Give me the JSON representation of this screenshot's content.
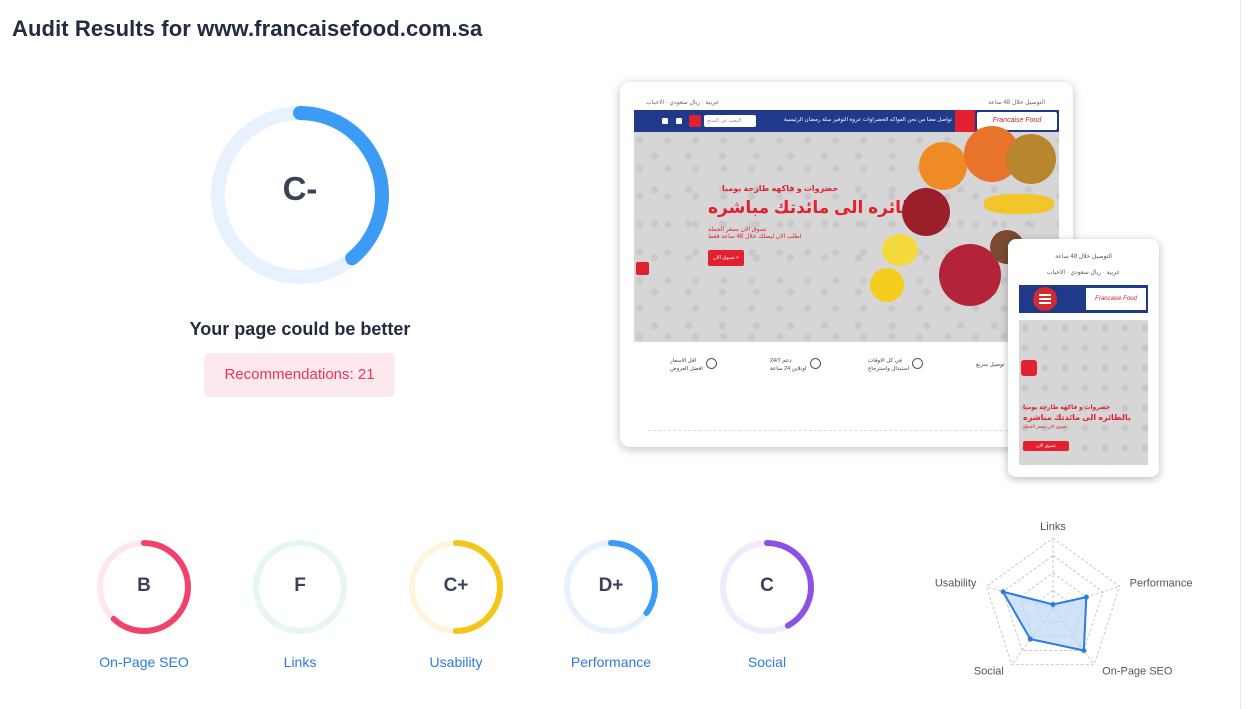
{
  "page_title": "Audit Results for www.francaisefood.com.sa",
  "overall": {
    "grade": "C-",
    "progress": 0.39,
    "color": "#3c9bf5",
    "track_color": "#e8f2fe",
    "verdict": "Your page could be better",
    "recommendations_label": "Recommendations: 21"
  },
  "desktop_preview": {
    "topbar_left": "عربية · ريال سعودي · الاحباب",
    "topbar_right": "التوصيل خلال 48 ساعة",
    "nav_items": "تواصل معنا   من نحن   الفواكه   الخضراوات   عروة التوفير   سلة رمضان   الرئيسية",
    "search_placeholder": "البحث عن المنتج",
    "logo_text": "Francaise Food",
    "hero_sub": "خضروات و فاكهه طازجة يوميا",
    "hero_title": "بالطائره الى مائدتك مباشره",
    "hero_line1": "تسوق الان بسعر الجملة",
    "hero_line2": "اطلب الان ليصلك خلال 48 ساعة فقط",
    "hero_button": "تسوق الان »",
    "features": [
      {
        "title": "اقل الاسعار",
        "sub": "افضل العروض"
      },
      {
        "title": "24/7 دعم",
        "sub": "اونلاين 24 ساعة"
      },
      {
        "title": "في كل الاوقات",
        "sub": "استبدال واسترجاع"
      },
      {
        "title": "توصيل سريع",
        "sub": ""
      }
    ]
  },
  "mobile_preview": {
    "top_text": "التوصيل خلال 48 ساعة",
    "selects": "عربية · ريال سعودي · الاحباب",
    "logo_text": "Francaise Food",
    "hero_sub": "خضروات و فاكهه طازجة يوميا",
    "hero_title": "بالطائره الى مائدتك مباشره",
    "hero_line": "تسوق الان بسعر الجملة",
    "hero_button": "تسوق الان"
  },
  "categories": [
    {
      "grade": "B",
      "label": "On-Page SEO",
      "progress": 0.62,
      "color": "#f0426c",
      "track": "#fde7ec"
    },
    {
      "grade": "F",
      "label": "Links",
      "progress": 0.0,
      "color": "#3ecf6e",
      "track": "#e6f8ec"
    },
    {
      "grade": "C+",
      "label": "Usability",
      "progress": 0.5,
      "color": "#f5c518",
      "track": "#fdf5dc"
    },
    {
      "grade": "D+",
      "label": "Performance",
      "progress": 0.35,
      "color": "#3c9bf5",
      "track": "#e8f2fe"
    },
    {
      "grade": "C",
      "label": "Social",
      "progress": 0.42,
      "color": "#8c52e6",
      "track": "#f0eafc"
    }
  ],
  "radar": {
    "axes": [
      "Links",
      "Performance",
      "On-Page SEO",
      "Social",
      "Usability"
    ],
    "values": [
      0.05,
      0.5,
      0.75,
      0.55,
      0.75
    ],
    "color": "#2b7be0",
    "fill": "#bcd7f7"
  }
}
